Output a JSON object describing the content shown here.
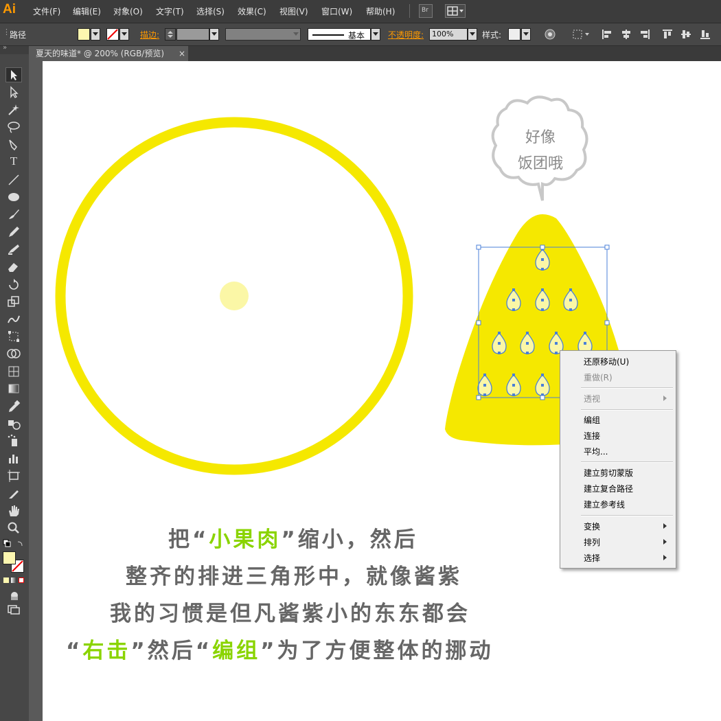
{
  "app": {
    "logo": "Ai"
  },
  "menubar": {
    "items": [
      "文件(F)",
      "编辑(E)",
      "对象(O)",
      "文字(T)",
      "选择(S)",
      "效果(C)",
      "视图(V)",
      "窗口(W)",
      "帮助(H)"
    ],
    "bridge_label": "Br"
  },
  "control_bar": {
    "selection_type": "路径",
    "stroke_label": "描边:",
    "stroke_style": "基本",
    "opacity_label": "不透明度:",
    "opacity_value": "100%",
    "style_label": "样式:"
  },
  "document_tab": {
    "title": "夏天的味道* @ 200% (RGB/预览)",
    "close": "×"
  },
  "artwork": {
    "bubble_line1": "好像",
    "bubble_line2": "饭团哦"
  },
  "context_menu": {
    "items": [
      {
        "label": "还原移动(U)",
        "enabled": true,
        "submenu": false
      },
      {
        "label": "重做(R)",
        "enabled": false,
        "submenu": false
      },
      {
        "label": "透视",
        "enabled": false,
        "submenu": true
      },
      {
        "label": "编组",
        "enabled": true,
        "submenu": false
      },
      {
        "label": "连接",
        "enabled": true,
        "submenu": false
      },
      {
        "label": "平均...",
        "enabled": true,
        "submenu": false
      },
      {
        "label": "建立剪切蒙版",
        "enabled": true,
        "submenu": false
      },
      {
        "label": "建立复合路径",
        "enabled": true,
        "submenu": false
      },
      {
        "label": "建立参考线",
        "enabled": true,
        "submenu": false
      },
      {
        "label": "变换",
        "enabled": true,
        "submenu": true
      },
      {
        "label": "排列",
        "enabled": true,
        "submenu": true
      },
      {
        "label": "选择",
        "enabled": true,
        "submenu": true
      }
    ]
  },
  "caption": {
    "line1": {
      "pre": "把“",
      "hl": "小果肉",
      "post": "”缩小，然后"
    },
    "line2": "整齐的排进三角形中，就像酱紫",
    "line3": "我的习惯是但凡酱紫小的东东都会",
    "line4": {
      "q1": "“",
      "hl1": "右击",
      "mid": "”然后“",
      "hl2": "编组",
      "post": "”为了方便整体的挪动"
    }
  },
  "colors": {
    "accent_yellow": "#f5e800",
    "seed_fill": "#fbf7a6",
    "selection_blue": "#4a7fd8",
    "highlight_green": "#8ad400",
    "fill_swatch": "#fdf7b0"
  },
  "icons": [
    "selection-icon",
    "direct-selection-icon",
    "magic-wand-icon",
    "lasso-icon",
    "pen-icon",
    "type-icon",
    "line-icon",
    "ellipse-icon",
    "paintbrush-icon",
    "pencil-icon",
    "blob-brush-icon",
    "eraser-icon",
    "rotate-icon",
    "scale-icon",
    "warp-icon",
    "free-transform-icon",
    "shape-builder-icon",
    "mesh-icon",
    "gradient-icon",
    "eyedropper-icon",
    "blend-icon",
    "symbol-sprayer-icon",
    "column-graph-icon",
    "artboard-icon",
    "slice-icon",
    "hand-icon",
    "zoom-icon"
  ]
}
